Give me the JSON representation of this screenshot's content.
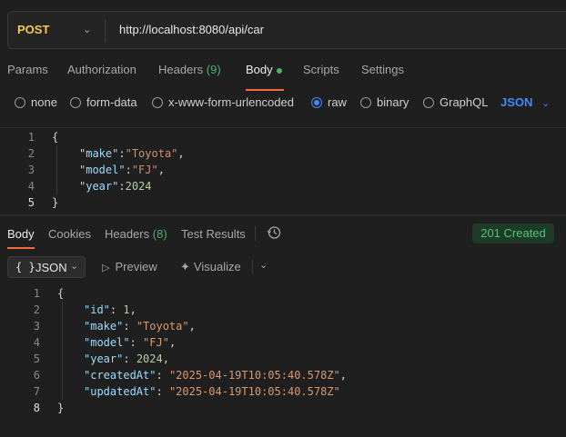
{
  "request": {
    "method": "POST",
    "url": "http://localhost:8080/api/car"
  },
  "request_tabs": [
    {
      "label": "Params"
    },
    {
      "label": "Authorization"
    },
    {
      "label": "Headers",
      "count": "(9)"
    },
    {
      "label": "Body"
    },
    {
      "label": "Scripts"
    },
    {
      "label": "Settings"
    }
  ],
  "body_types": {
    "options": [
      "none",
      "form-data",
      "x-www-form-urlencoded",
      "raw",
      "binary",
      "GraphQL"
    ],
    "selected": "raw",
    "format": "JSON"
  },
  "request_body": {
    "line_numbers": [
      "1",
      "2",
      "3",
      "4",
      "5"
    ],
    "open_brace": "{",
    "close_brace": "}",
    "fields": [
      {
        "key": "\"make\"",
        "sep": ":",
        "value": "\"Toyota\"",
        "trail": ","
      },
      {
        "key": "\"model\"",
        "sep": ":",
        "value": "\"FJ\"",
        "trail": ","
      },
      {
        "key": "\"year\"",
        "sep": ":",
        "value": "2024",
        "trail": ""
      }
    ]
  },
  "response_tabs": [
    {
      "label": "Body"
    },
    {
      "label": "Cookies"
    },
    {
      "label": "Headers",
      "count": "(8)"
    },
    {
      "label": "Test Results"
    }
  ],
  "response_status": "201 Created",
  "response_toolbar": {
    "format_label": "JSON",
    "format_icon": "{ }",
    "preview": "Preview",
    "visualize": "Visualize"
  },
  "response_body": {
    "line_numbers": [
      "1",
      "2",
      "3",
      "4",
      "5",
      "6",
      "7",
      "8"
    ],
    "open_brace": "{",
    "close_brace": "}",
    "fields": [
      {
        "key": "\"id\"",
        "sep": ": ",
        "value": "1",
        "trail": ","
      },
      {
        "key": "\"make\"",
        "sep": ": ",
        "value": "\"Toyota\"",
        "trail": ","
      },
      {
        "key": "\"model\"",
        "sep": ": ",
        "value": "\"FJ\"",
        "trail": ","
      },
      {
        "key": "\"year\"",
        "sep": ": ",
        "value": "2024",
        "trail": ","
      },
      {
        "key": "\"createdAt\"",
        "sep": ": ",
        "value": "\"2025-04-19T10:05:40.578Z\"",
        "trail": ","
      },
      {
        "key": "\"updatedAt\"",
        "sep": ": ",
        "value": "\"2025-04-19T10:05:40.578Z\"",
        "trail": ""
      }
    ]
  },
  "colors": {
    "accent": "#f26b3a",
    "method": "#f5c94b",
    "status_ok": "#54c27a",
    "link_blue": "#3d8bff"
  }
}
